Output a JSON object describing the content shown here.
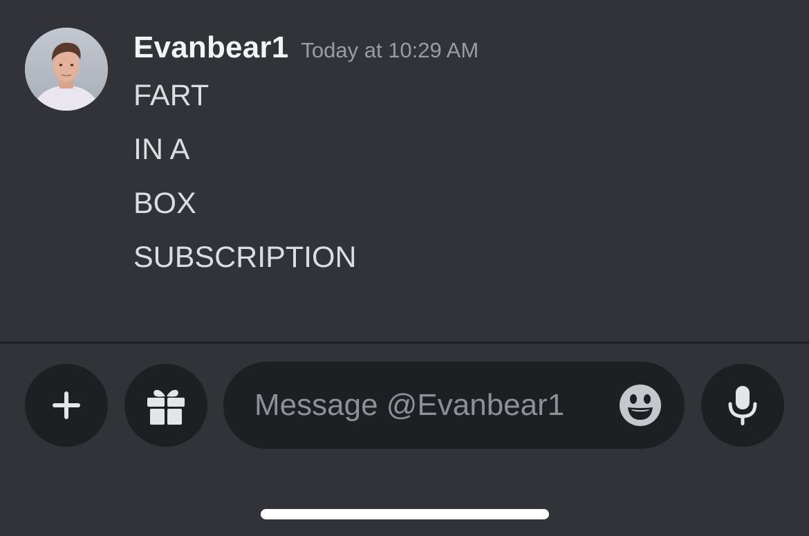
{
  "message": {
    "author": "Evanbear1",
    "timestamp": "Today at 10:29 AM",
    "lines": [
      "FART",
      "IN A",
      "BOX",
      "SUBSCRIPTION"
    ],
    "avatar_icon": "user-avatar-photo"
  },
  "composer": {
    "placeholder": "Message @Evanbear1",
    "buttons": {
      "add": "plus-icon",
      "gift": "gift-icon",
      "emoji": "emoji-smile-icon",
      "voice": "microphone-icon"
    }
  },
  "colors": {
    "background": "#313338",
    "input_background": "#1e1f22",
    "username": "#f2f3f5",
    "message_text": "#dbdee1",
    "muted_text": "#9a9ca3"
  }
}
